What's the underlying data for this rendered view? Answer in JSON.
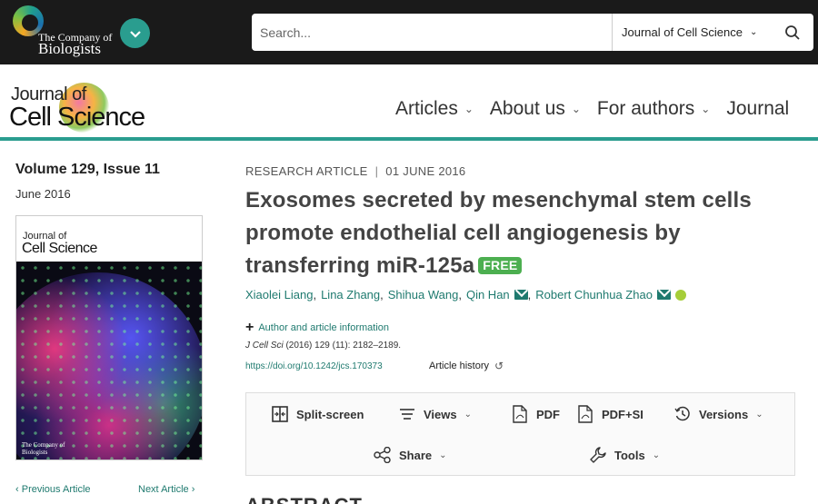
{
  "topbar": {
    "publisher_line1": "The Company of",
    "publisher_line2": "Biologists",
    "search_placeholder": "Search...",
    "search_scope": "Journal of Cell Science"
  },
  "journal": {
    "logo_line1": "Journal of",
    "logo_line2": "Cell Science",
    "nav": [
      "Articles",
      "About us",
      "For authors",
      "Journal"
    ]
  },
  "issue": {
    "volume": "Volume 129, Issue 11",
    "date": "June 2016",
    "cover_line1": "Journal of",
    "cover_line2": "Cell Science",
    "cover_publisher": "The Company of\nBiologists",
    "prev_article": "Previous Article",
    "next_article": "Next Article"
  },
  "article": {
    "type": "RESEARCH ARTICLE",
    "date": "01 JUNE 2016",
    "title": "Exosomes secreted by mesenchymal stem cells promote endothelial cell angiogenesis by transferring miR-125a",
    "free_badge": "FREE",
    "authors": [
      "Xiaolei Liang",
      "Lina Zhang",
      "Shihua Wang",
      "Qin Han",
      "Robert Chunhua Zhao"
    ],
    "author_info": "Author and article information",
    "citation_journal": "J Cell Sci",
    "citation_rest": " (2016) 129 (11): 2182–2189.",
    "doi": "https://doi.org/10.1242/jcs.170373",
    "history": "Article history"
  },
  "toolbar": {
    "split_screen": "Split-screen",
    "views": "Views",
    "pdf": "PDF",
    "pdf_si": "PDF+SI",
    "versions": "Versions",
    "share": "Share",
    "tools": "Tools"
  },
  "abstract_heading": "ABSTRACT",
  "colors": {
    "accent": "#2a9d8f",
    "link": "#1f7a6f",
    "badge": "#4caf50"
  }
}
